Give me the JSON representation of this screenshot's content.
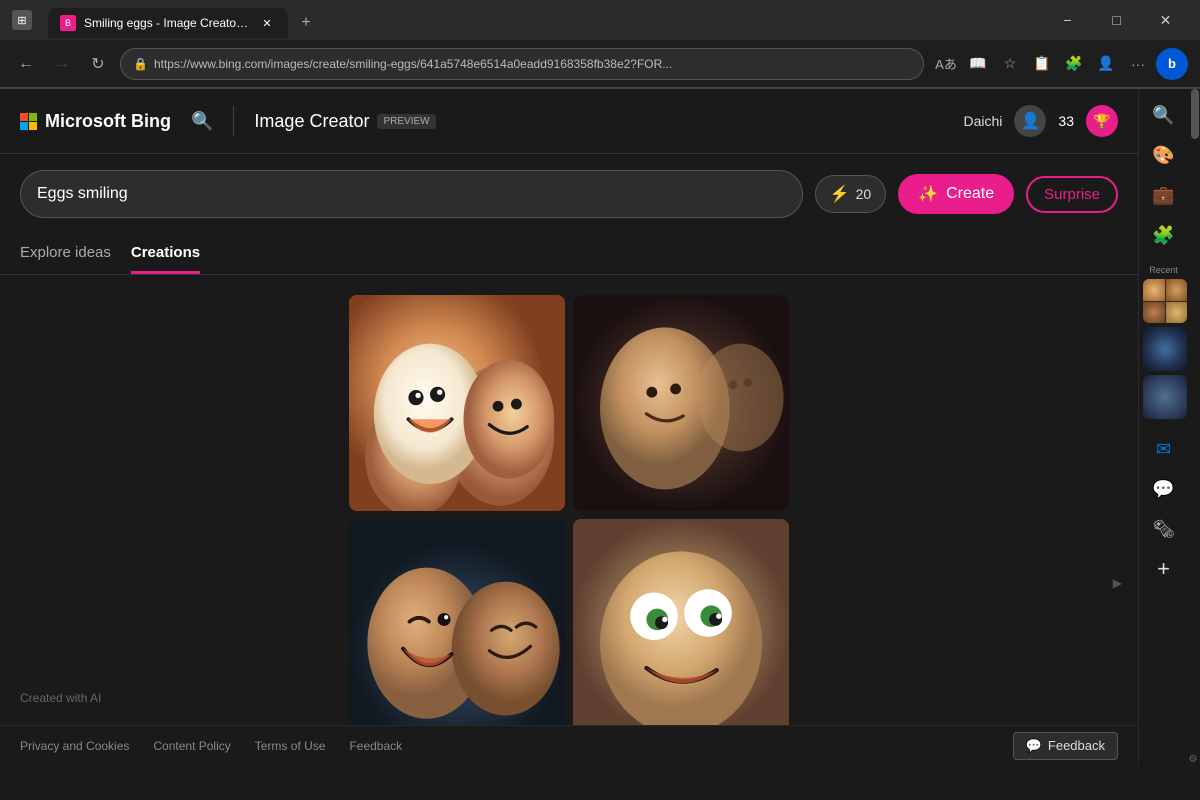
{
  "browser": {
    "tab_title": "Smiling eggs - Image Creator fro",
    "tab_url": "https://www.bing.com/images/create/smiling-eggs/641a5748e6514a0eadd9168358fb38e2?FOR...",
    "new_tab_tooltip": "New tab",
    "minimize": "−",
    "maximize": "□",
    "close": "✕"
  },
  "nav": {
    "bing_label": "Microsoft Bing",
    "image_creator_label": "Image Creator",
    "preview_badge": "PREVIEW",
    "search_placeholder": "Eggs smiling",
    "search_value": "Eggs smiling",
    "boost_count": "20",
    "create_label": "Create",
    "surprise_label": "Surprise",
    "user_name": "Daichi",
    "points": "33"
  },
  "tabs": {
    "explore_ideas": "Explore ideas",
    "creations": "Creations"
  },
  "gallery": {
    "created_with_ai": "Created with AI"
  },
  "recent": {
    "title": "Recent"
  },
  "footer": {
    "privacy": "Privacy and Cookies",
    "content_policy": "Content Policy",
    "terms": "Terms of Use",
    "feedback": "Feedback"
  },
  "sidebar_icons": {
    "search": "🔍",
    "palette": "🎨",
    "briefcase": "💼",
    "puzzle": "🧩",
    "outlook": "✉",
    "messenger": "💬",
    "news": "📰",
    "add": "+"
  }
}
